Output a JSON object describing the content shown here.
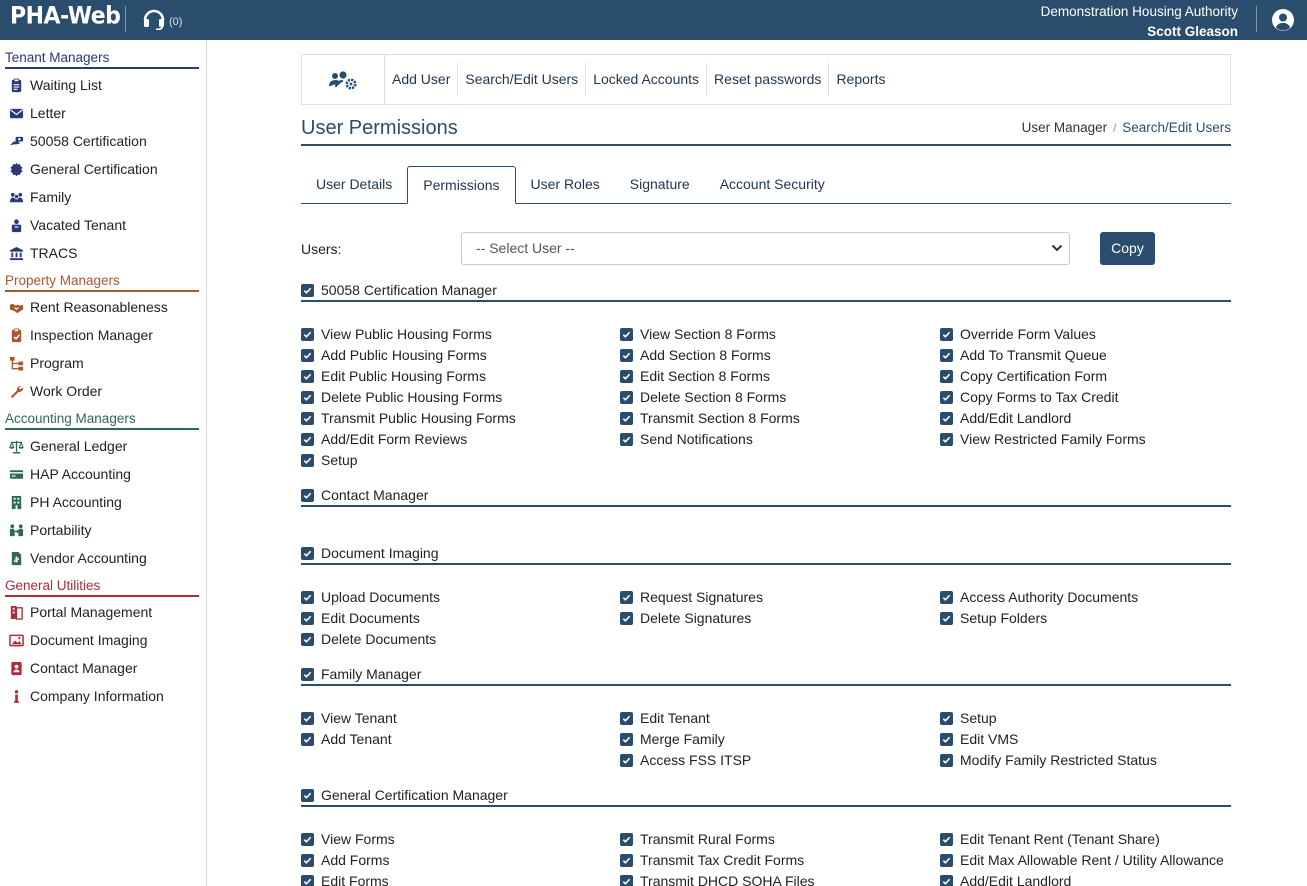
{
  "header": {
    "logo": "PHA-Web",
    "support_count": "(0)",
    "organization": "Demonstration Housing Authority",
    "user": "Scott Gleason"
  },
  "sidebar": {
    "tenant_title": "Tenant Managers",
    "tenant": [
      {
        "label": "Waiting List",
        "icon": "clipboard-icon"
      },
      {
        "label": "Letter",
        "icon": "envelope-icon"
      },
      {
        "label": "50058 Certification",
        "icon": "hand-money-icon"
      },
      {
        "label": "General Certification",
        "icon": "certificate-icon"
      },
      {
        "label": "Family",
        "icon": "family-icon"
      },
      {
        "label": "Vacated Tenant",
        "icon": "suitcase-user-icon"
      },
      {
        "label": "TRACS",
        "icon": "bank-icon"
      }
    ],
    "property_title": "Property Managers",
    "property": [
      {
        "label": "Rent Reasonableness",
        "icon": "handshake-icon"
      },
      {
        "label": "Inspection Manager",
        "icon": "clipboard-check-icon"
      },
      {
        "label": "Program",
        "icon": "sitemap-icon"
      },
      {
        "label": "Work Order",
        "icon": "wrench-icon"
      }
    ],
    "accounting_title": "Accounting Managers",
    "accounting": [
      {
        "label": "General Ledger",
        "icon": "balance-scale-icon"
      },
      {
        "label": "HAP Accounting",
        "icon": "money-card-icon"
      },
      {
        "label": "PH Accounting",
        "icon": "building-icon"
      },
      {
        "label": "Portability",
        "icon": "people-exchange-icon"
      },
      {
        "label": "Vendor Accounting",
        "icon": "invoice-icon"
      }
    ],
    "utilities_title": "General Utilities",
    "utilities": [
      {
        "label": "Portal Management",
        "icon": "portal-icon"
      },
      {
        "label": "Document Imaging",
        "icon": "image-icon"
      },
      {
        "label": "Contact Manager",
        "icon": "address-book-icon"
      },
      {
        "label": "Company Information",
        "icon": "info-icon"
      }
    ]
  },
  "toolbar": {
    "icon": "users-cog-icon",
    "links": [
      "Add User",
      "Search/Edit Users",
      "Locked Accounts",
      "Reset passwords",
      "Reports"
    ]
  },
  "page": {
    "title": "User Permissions",
    "breadcrumb": [
      "User Manager",
      "Search/Edit Users"
    ]
  },
  "tabs": [
    "User Details",
    "Permissions",
    "User Roles",
    "Signature",
    "Account Security"
  ],
  "active_tab": "Permissions",
  "users": {
    "label": "Users:",
    "select_value": "-- Select User --",
    "copy_label": "Copy"
  },
  "groups": [
    {
      "title": "50058 Certification Manager",
      "columns": [
        [
          "View Public Housing Forms",
          "Add Public Housing Forms",
          "Edit Public Housing Forms",
          "Delete Public Housing Forms",
          "Transmit Public Housing Forms",
          "Add/Edit Form Reviews",
          "Setup"
        ],
        [
          "View Section 8 Forms",
          "Add Section 8 Forms",
          "Edit Section 8 Forms",
          "Delete Section 8 Forms",
          "Transmit Section 8 Forms",
          "Send Notifications"
        ],
        [
          "Override Form Values",
          "Add To Transmit Queue",
          "Copy Certification Form",
          "Copy Forms to Tax Credit",
          "Add/Edit Landlord",
          "View Restricted Family Forms"
        ]
      ]
    },
    {
      "title": "Contact Manager",
      "columns": [
        [],
        [],
        []
      ]
    },
    {
      "title": "Document Imaging",
      "columns": [
        [
          "Upload Documents",
          "Edit Documents",
          "Delete Documents"
        ],
        [
          "Request Signatures",
          "Delete Signatures"
        ],
        [
          "Access Authority Documents",
          "Setup Folders"
        ]
      ]
    },
    {
      "title": "Family Manager",
      "columns": [
        [
          "View Tenant",
          "Add Tenant"
        ],
        [
          "Edit Tenant",
          "Merge Family",
          "Access FSS ITSP"
        ],
        [
          "Setup",
          "Edit VMS",
          "Modify Family Restricted Status"
        ]
      ]
    },
    {
      "title": "General Certification Manager",
      "columns": [
        [
          "View Forms",
          "Add Forms",
          "Edit Forms"
        ],
        [
          "Transmit Rural Forms",
          "Transmit Tax Credit Forms",
          "Transmit DHCD SOHA Files"
        ],
        [
          "Edit Tenant Rent (Tenant Share)",
          "Edit Max Allowable Rent / Utility Allowance",
          "Add/Edit Landlord"
        ]
      ]
    }
  ],
  "colors": {
    "primary": "#2a4d6e",
    "tenant": "#2b3a76",
    "property": "#a8572f",
    "accounting": "#2d6b50",
    "utilities": "#a92d3a"
  }
}
